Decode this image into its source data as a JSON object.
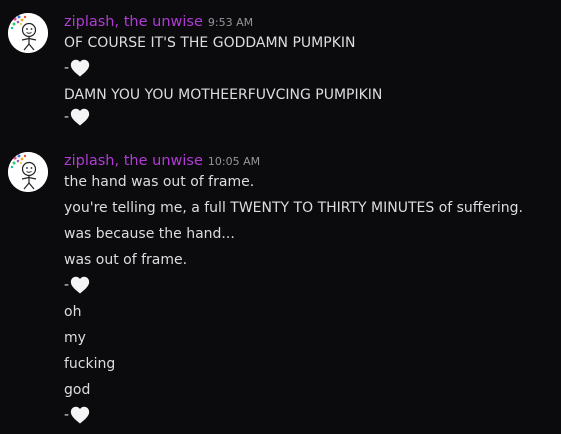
{
  "messages": [
    {
      "author": "ziplash, the unwise",
      "timestamp": "9:53 AM",
      "lines": [
        "OF COURSE IT'S THE GODDAMN PUMPKIN",
        "-",
        "DAMN YOU YOU MOTHEERFUVCING PUMPIKIN",
        "-"
      ]
    },
    {
      "author": "ziplash, the unwise",
      "timestamp": "10:05 AM",
      "lines": [
        "the hand was out of frame.",
        "you're telling me, a full TWENTY TO THIRTY MINUTES of suffering.",
        "was because the hand...",
        "was out of frame.",
        "-",
        "oh",
        "my",
        "fucking",
        "god",
        "-"
      ]
    }
  ],
  "icons": {
    "avatar": "doodle-avatar",
    "emoji": "white-heart-icon"
  },
  "colors": {
    "background": "#0b0b0d",
    "username": "#b13bd6",
    "text": "#dcdde1",
    "timestamp": "#94959c",
    "heart": "#f4f4f4"
  }
}
